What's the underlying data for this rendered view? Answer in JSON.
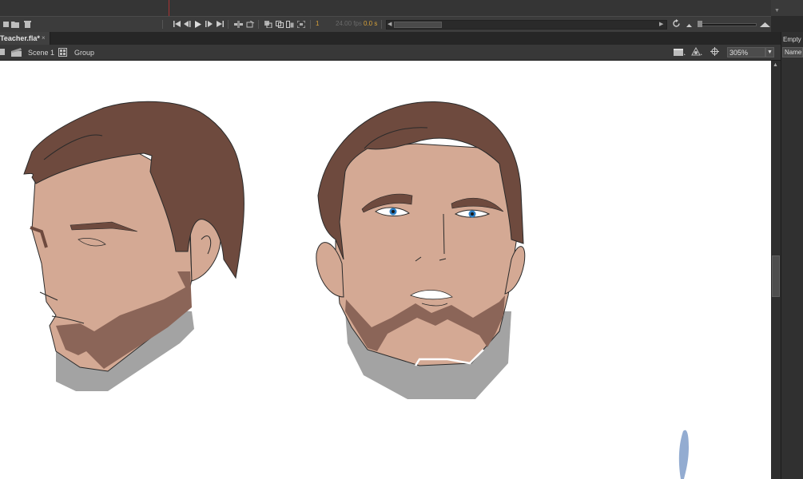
{
  "timeline": {
    "current_frame": "1",
    "fps": "24.00 fps",
    "time": "0.0 s"
  },
  "document": {
    "tab_title": "Teacher.fla*",
    "close_glyph": "×"
  },
  "edit_bar": {
    "breadcrumb": [
      "Scene 1",
      "Group"
    ],
    "zoom_level": "305%"
  },
  "right_panel": {
    "empty_label": "Empty",
    "name_field": "Name"
  },
  "colors": {
    "hair": "#6e4a3e",
    "skin": "#d4a994",
    "beard": "#8b6558",
    "shadow": "#9e9e9e",
    "eye_blue": "#2a7ec4",
    "brush_blue": "#93acd1",
    "panel_dark": "#3c3c3c",
    "accent_orange": "#d8a23a"
  },
  "icons": [
    "new-layer-icon",
    "folder-icon",
    "trash-icon",
    "first-frame-icon",
    "step-back-icon",
    "play-icon",
    "step-forward-icon",
    "last-frame-icon",
    "loop-icon",
    "onion-skin-icon",
    "onion-outline-icon",
    "edit-multiple-icon",
    "onion-markers-icon",
    "center-frame-icon",
    "clapper-icon",
    "scene-icon",
    "group-icon",
    "edit-symbols-icon",
    "snap-icon",
    "zoom-dropdown-icon"
  ]
}
